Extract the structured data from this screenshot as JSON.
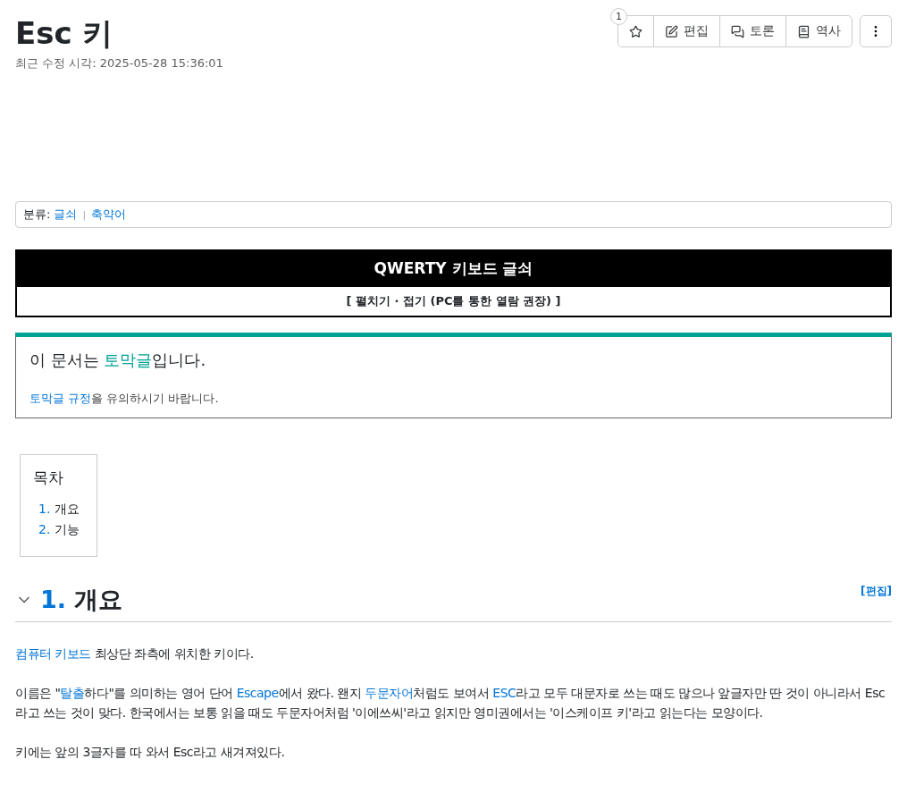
{
  "title": "Esc 키",
  "last_modified": "최근 수정 시각: 2025-05-28 15:36:01",
  "star_count": "1",
  "actions": [
    {
      "kind": "star"
    },
    {
      "kind": "edit",
      "label": "편집"
    },
    {
      "kind": "discuss",
      "label": "토론"
    },
    {
      "kind": "history",
      "label": "역사"
    }
  ],
  "category": {
    "label": "분류:",
    "items": [
      "글쇠",
      "축약어"
    ],
    "separator": "|"
  },
  "navbox": {
    "title": "QWERTY 키보드 글쇠",
    "toggle": "[ 펼치기 · 접기 (PC를 통한 열람 권장) ]"
  },
  "notice": {
    "title_before": "이 문서는 ",
    "title_link": "토막글",
    "title_after": "입니다.",
    "body_link": "토막글 규정",
    "body_after": "을 유의하시기 바랍니다."
  },
  "toc": {
    "title": "목차",
    "items": [
      {
        "number": "1.",
        "label": "개요"
      },
      {
        "number": "2.",
        "label": "기능"
      }
    ]
  },
  "section": {
    "number": "1.",
    "title": "개요",
    "edit": "[편집]",
    "expanded": true
  },
  "paragraphs": [
    {
      "segments": [
        {
          "text": "컴퓨터 키보드",
          "kind": "link"
        },
        {
          "text": " 최상단 좌측에 위치한 키이다.",
          "kind": "text"
        }
      ]
    },
    {
      "segments": [
        {
          "text": "이름은 \"",
          "kind": "text"
        },
        {
          "text": "탈출",
          "kind": "link"
        },
        {
          "text": "하다\"를 의미하는 영어 단어 ",
          "kind": "text"
        },
        {
          "text": "Escape",
          "kind": "link"
        },
        {
          "text": "에서 왔다. 왠지 ",
          "kind": "text"
        },
        {
          "text": "두문자어",
          "kind": "link"
        },
        {
          "text": "처럼도 보여서 ",
          "kind": "text"
        },
        {
          "text": "ESC",
          "kind": "link"
        },
        {
          "text": "라고 모두 대문자로 쓰는 때도 많으나 앞글자만 딴 것이 아니라서 Esc라고 쓰는 것이 맞다. 한국에서는 보통 읽을 때도 두문자어처럼 '이에쓰씨'라고 읽지만 영미권에서는 '이스케이프 키'라고 읽는다는 모양이다.",
          "kind": "text"
        }
      ]
    },
    {
      "segments": [
        {
          "text": "키에는 앞의 3글자를 따 와서 Esc라고 새겨져있다.",
          "kind": "text"
        }
      ]
    }
  ]
}
